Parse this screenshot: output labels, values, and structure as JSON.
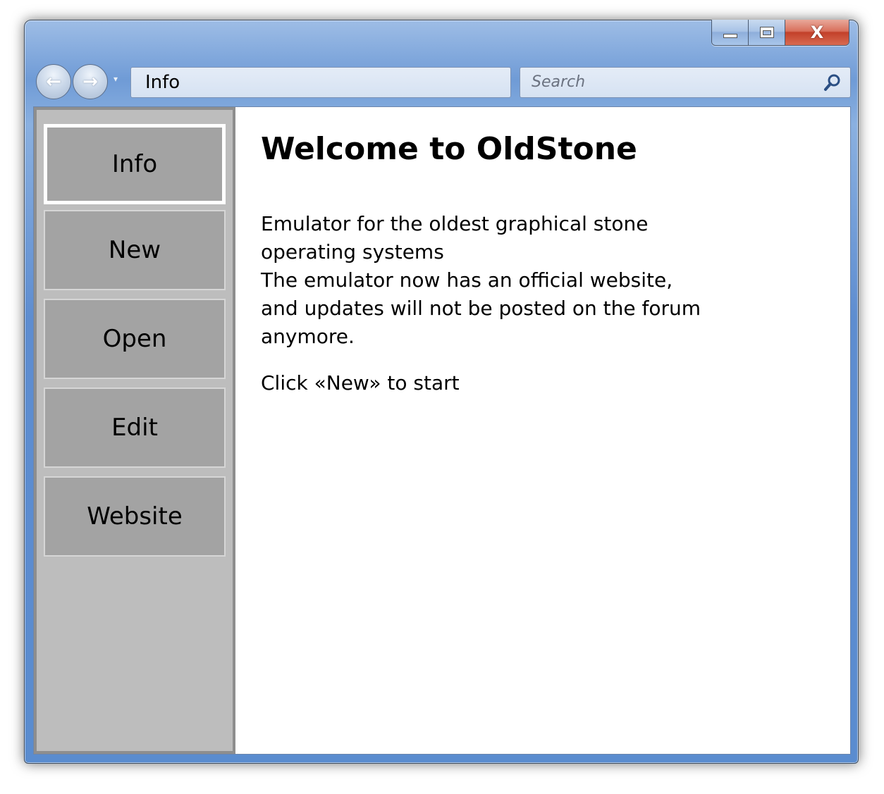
{
  "window": {
    "caption_close": "X"
  },
  "nav": {
    "back_glyph": "←",
    "forward_glyph": "→",
    "dropdown_glyph": "▾",
    "address": "Info",
    "search_placeholder": "Search"
  },
  "sidebar": {
    "items": [
      {
        "label": "Info",
        "active": true
      },
      {
        "label": "New",
        "active": false
      },
      {
        "label": "Open",
        "active": false
      },
      {
        "label": "Edit",
        "active": false
      },
      {
        "label": "Website",
        "active": false
      }
    ]
  },
  "main": {
    "title": "Welcome to OldStone",
    "description": "Emulator for the oldest graphical stone operating systems\nThe emulator now has an official website, and updates will not be posted on the forum anymore.",
    "start_hint": "Click «New» to start"
  },
  "colors": {
    "sidebar_bg": "#bdbdbd",
    "button_bg": "#a3a3a3",
    "active_border": "#ffffff"
  }
}
